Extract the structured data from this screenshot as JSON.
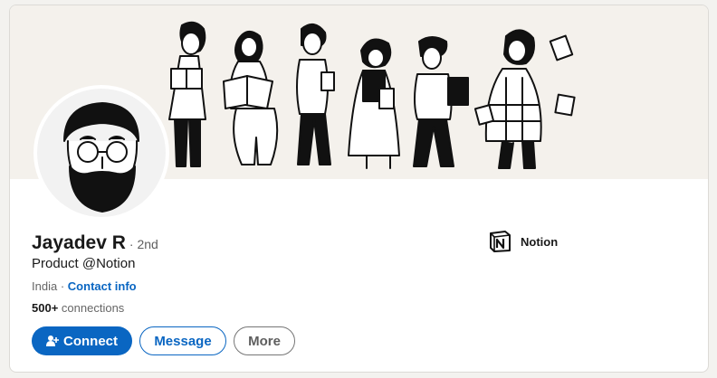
{
  "profile": {
    "name": "Jayadev R",
    "degree": "· 2nd",
    "headline": "Product @Notion",
    "location": "India",
    "separator": "·",
    "contact_info": "Contact info",
    "connections_count": "500+",
    "connections_label": "connections"
  },
  "actions": {
    "connect_label": "Connect",
    "message_label": "Message",
    "more_label": "More"
  },
  "company": {
    "name": "Notion",
    "logo_icon": "notion-logo-icon"
  },
  "colors": {
    "accent": "#0a66c2",
    "banner_bg": "#f4f1ec",
    "page_bg": "#f3f2ef"
  }
}
